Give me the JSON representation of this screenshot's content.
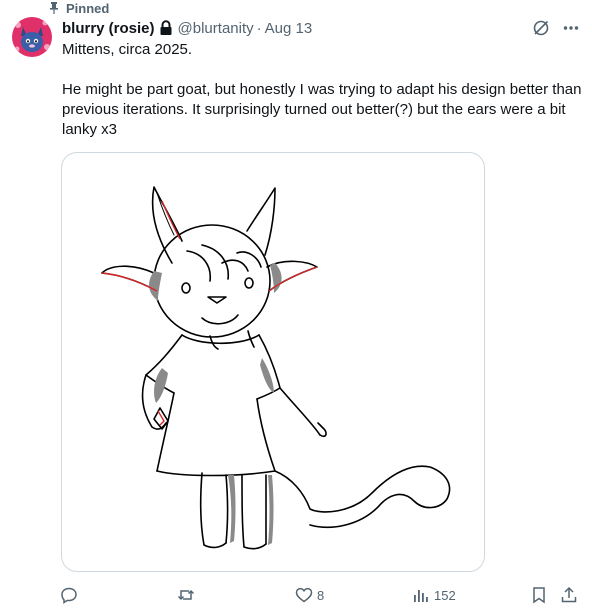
{
  "pinned": {
    "label": "Pinned"
  },
  "author": {
    "display_name": "blurry (rosie)",
    "handle": "@blurtanity",
    "separator": "·",
    "date": "Aug 13"
  },
  "post": {
    "text_line1": "Mittens, circa 2025.",
    "text_line2": "He might be part goat, but honestly I was trying to adapt his design better than previous iterations. It surprisingly turned out better(?) but the ears were a bit lanky x3"
  },
  "actions": {
    "likes": "8",
    "views": "152"
  },
  "colors": {
    "text_primary": "#0f1419",
    "text_secondary": "#536471",
    "border": "#cfd9de",
    "avatar_bg": "#e0306a",
    "avatar_character": "#3a5ea8"
  },
  "icons": [
    "pin-icon",
    "lock-icon",
    "grok-icon",
    "more-icon",
    "reply-icon",
    "repost-icon",
    "like-icon",
    "views-icon",
    "bookmark-icon",
    "share-icon"
  ]
}
